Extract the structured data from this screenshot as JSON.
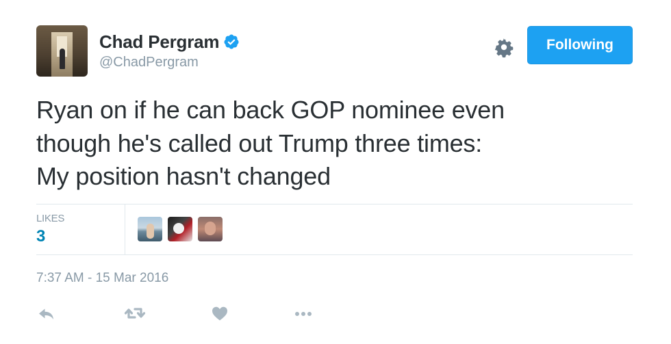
{
  "author": {
    "name": "Chad Pergram",
    "handle": "@ChadPergram",
    "verified": true
  },
  "header": {
    "settings_icon": "gear-icon",
    "follow_button_label": "Following"
  },
  "tweet": {
    "text_lines": [
      "Ryan on if he can back GOP nominee even",
      "though he's called out Trump three times:",
      "My position hasn't changed"
    ],
    "timestamp": "7:37 AM - 15 Mar 2016"
  },
  "stats": {
    "likes_label": "LIKES",
    "likes_count": "3",
    "likers": [
      {
        "avatar": "liker-avatar-1"
      },
      {
        "avatar": "liker-avatar-2"
      },
      {
        "avatar": "liker-avatar-3"
      }
    ]
  },
  "actions": [
    {
      "name": "reply",
      "icon": "reply-icon"
    },
    {
      "name": "retweet",
      "icon": "retweet-icon"
    },
    {
      "name": "like",
      "icon": "heart-icon"
    },
    {
      "name": "more",
      "icon": "more-icon"
    }
  ],
  "colors": {
    "accent": "#1da1f2",
    "text": "#292f33",
    "secondary_text": "#8899a6",
    "count_blue": "#0084b4",
    "icon_gray": "#aab8c2",
    "verified_blue": "#1da1f2"
  }
}
